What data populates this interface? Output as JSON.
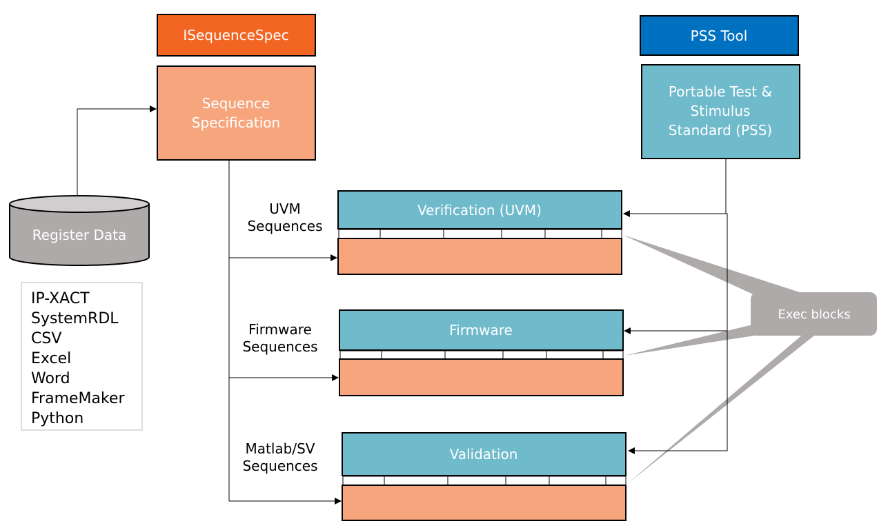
{
  "left": {
    "spec_header": "ISequenceSpec",
    "spec_box": [
      "Sequence",
      "Specification"
    ],
    "database": "Register Data",
    "formats": [
      "IP-XACT",
      "SystemRDL",
      "CSV",
      "Excel",
      "Word",
      "FrameMaker",
      "Python"
    ]
  },
  "right": {
    "tool_header": "PSS Tool",
    "pss_box": [
      "Portable Test &",
      "Stimulus",
      "Standard (PSS)"
    ]
  },
  "rows": [
    {
      "label": [
        "UVM",
        "Sequences"
      ],
      "block": "Verification (UVM)"
    },
    {
      "label": [
        "Firmware",
        "Sequences"
      ],
      "block": "Firmware"
    },
    {
      "label": [
        "Matlab/SV",
        "Sequences"
      ],
      "block": "Validation"
    }
  ],
  "callout": "Exec blocks",
  "colors": {
    "orange_dark": "#F26522",
    "orange_light": "#F6A57D",
    "blue_dark": "#0070C0",
    "teal": "#6FBACB",
    "gray": "#ADAAA9"
  }
}
